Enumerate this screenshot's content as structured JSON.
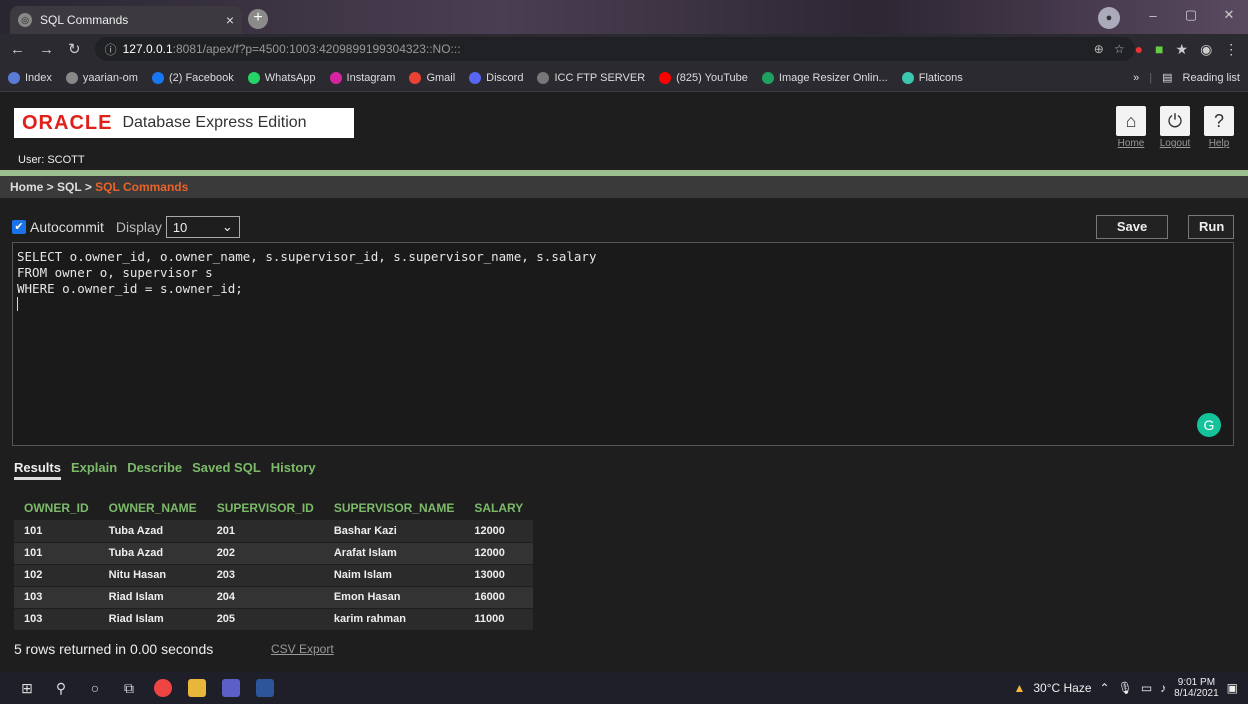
{
  "browser": {
    "tab_title": "SQL Commands",
    "url_host": "127.0.0.1",
    "url_rest": ":8081/apex/f?p=4500:1003:4209899199304323::NO:::",
    "bookmarks": [
      {
        "label": "Index",
        "color": "#5a7bd6"
      },
      {
        "label": "yaarian-om",
        "color": "#888888"
      },
      {
        "label": "(2) Facebook",
        "color": "#1877f2"
      },
      {
        "label": "WhatsApp",
        "color": "#25d366"
      },
      {
        "label": "Instagram",
        "color": "#d6249f"
      },
      {
        "label": "Gmail",
        "color": "#ea4335"
      },
      {
        "label": "Discord",
        "color": "#5865f2"
      },
      {
        "label": "ICC FTP SERVER",
        "color": "#777777"
      },
      {
        "label": "(825) YouTube",
        "color": "#ff0000"
      },
      {
        "label": "Image Resizer Onlin...",
        "color": "#20a060"
      },
      {
        "label": "Flaticons",
        "color": "#3cc7b1"
      }
    ],
    "reading_list": "Reading list"
  },
  "apex": {
    "logo": "ORACLE",
    "product": "Database Express Edition",
    "user": "User: SCOTT",
    "home_label": "Home",
    "logout_label": "Logout",
    "help_label": "Help",
    "crumb_home": "Home",
    "crumb_sep1": " > ",
    "crumb_sql": "SQL",
    "crumb_sep2": " > ",
    "crumb_current": "SQL Commands"
  },
  "toolbar": {
    "autocommit": "Autocommit",
    "display": "Display",
    "display_value": "10",
    "save": "Save",
    "run": "Run"
  },
  "editor": {
    "line1": "SELECT o.owner_id, o.owner_name, s.supervisor_id, s.supervisor_name, s.salary",
    "line2": "FROM owner o, supervisor s",
    "line3": "WHERE o.owner_id = s.owner_id;"
  },
  "result_tabs": [
    "Results",
    "Explain",
    "Describe",
    "Saved SQL",
    "History"
  ],
  "results": {
    "columns": [
      "OWNER_ID",
      "OWNER_NAME",
      "SUPERVISOR_ID",
      "SUPERVISOR_NAME",
      "SALARY"
    ],
    "rows": [
      [
        "101",
        "Tuba Azad",
        "201",
        "Bashar Kazi",
        "12000"
      ],
      [
        "101",
        "Tuba Azad",
        "202",
        "Arafat Islam",
        "12000"
      ],
      [
        "102",
        "Nitu Hasan",
        "203",
        "Naim Islam",
        "13000"
      ],
      [
        "103",
        "Riad Islam",
        "204",
        "Emon Hasan",
        "16000"
      ],
      [
        "103",
        "Riad Islam",
        "205",
        "karim rahman",
        "11000"
      ]
    ],
    "summary": "5 rows returned in 0.00 seconds",
    "csv": "CSV Export"
  },
  "taskbar": {
    "weather": "30°C  Haze",
    "time": "9:01 PM",
    "date": "8/14/2021"
  }
}
